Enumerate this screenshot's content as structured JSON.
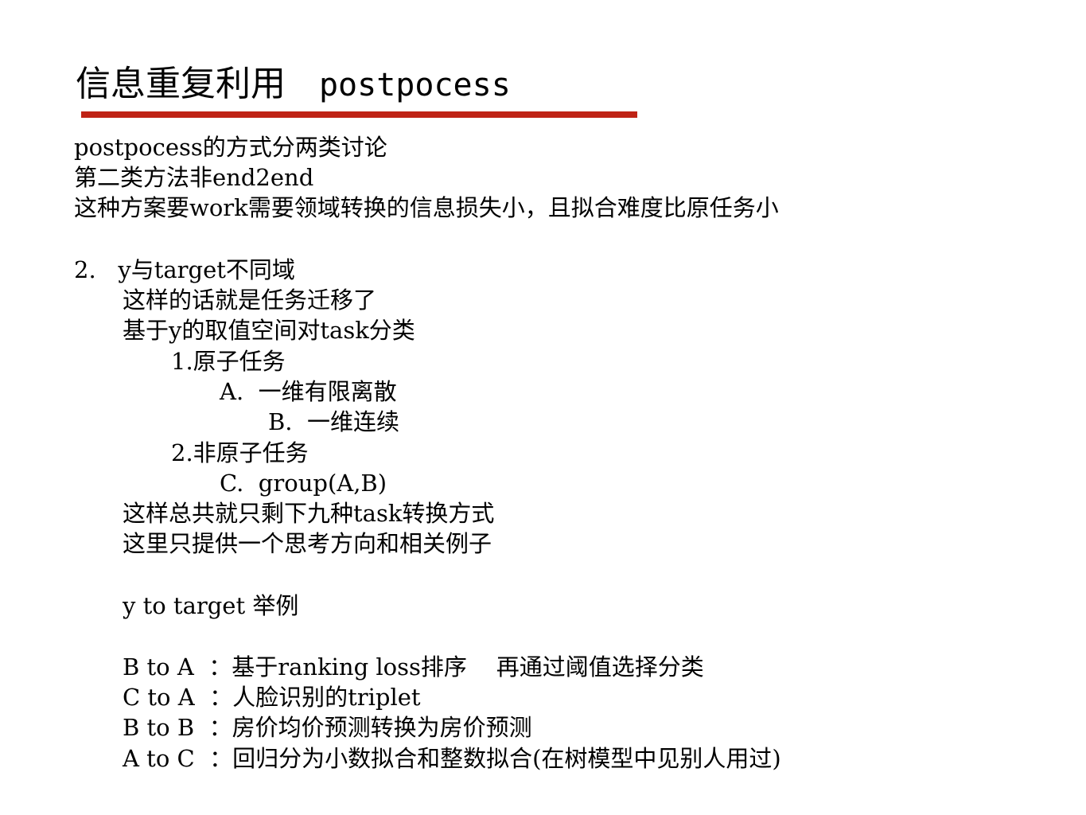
{
  "slide": {
    "title_zh": "信息重复利用",
    "title_en": "postpocess",
    "accent_color": "#bf2315"
  },
  "body": {
    "lines": [
      "postpocess的方式分两类讨论",
      "第二类方法非end2end",
      "这种方案要work需要领域转换的信息损失小，且拟合难度比原任务小",
      "2.   y与target不同域",
      "这样的话就是任务迁移了",
      "基于y的取值空间对task分类",
      "1.原子任务",
      "A.  一维有限离散",
      "B.  一维连续",
      "2.非原子任务",
      "C.  group(A,B)",
      "这样总共就只剩下九种task转换方式",
      "这里只提供一个思考方向和相关例子",
      "y to target 举例",
      "B to A  ：基于ranking loss排序    再通过阈值选择分类",
      "C to A  ：人脸识别的triplet",
      "B to B  ：房价均价预测转换为房价预测",
      "A to C  ：回归分为小数拟合和整数拟合(在树模型中见别人用过)"
    ]
  }
}
